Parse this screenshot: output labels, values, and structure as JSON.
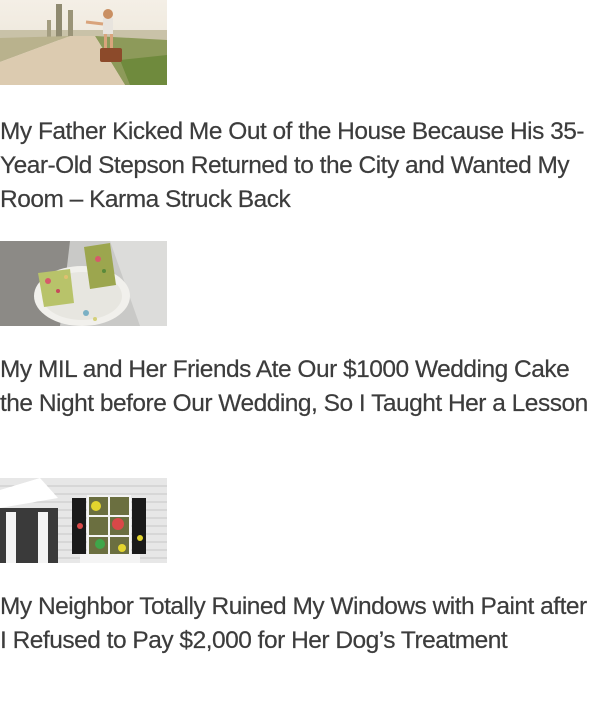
{
  "articles": [
    {
      "image_alt": "girl-with-suitcase-on-country-road",
      "title": "My Father Kicked Me Out of the House Because His 35-Year-Old Stepson Returned to the City and Wanted My Room – Karma Struck Back"
    },
    {
      "image_alt": "eaten-wedding-cake-on-plate",
      "title": "My MIL and Her Friends Ate Our $1000 Wedding Cake the Night before Our Wedding, So I Taught Her a Lesson"
    },
    {
      "image_alt": "house-window-splattered-with-paint",
      "title": "My Neighbor Totally Ruined My Windows with Paint after I Refused to Pay $2,000 for Her Dog’s Treatment"
    }
  ]
}
